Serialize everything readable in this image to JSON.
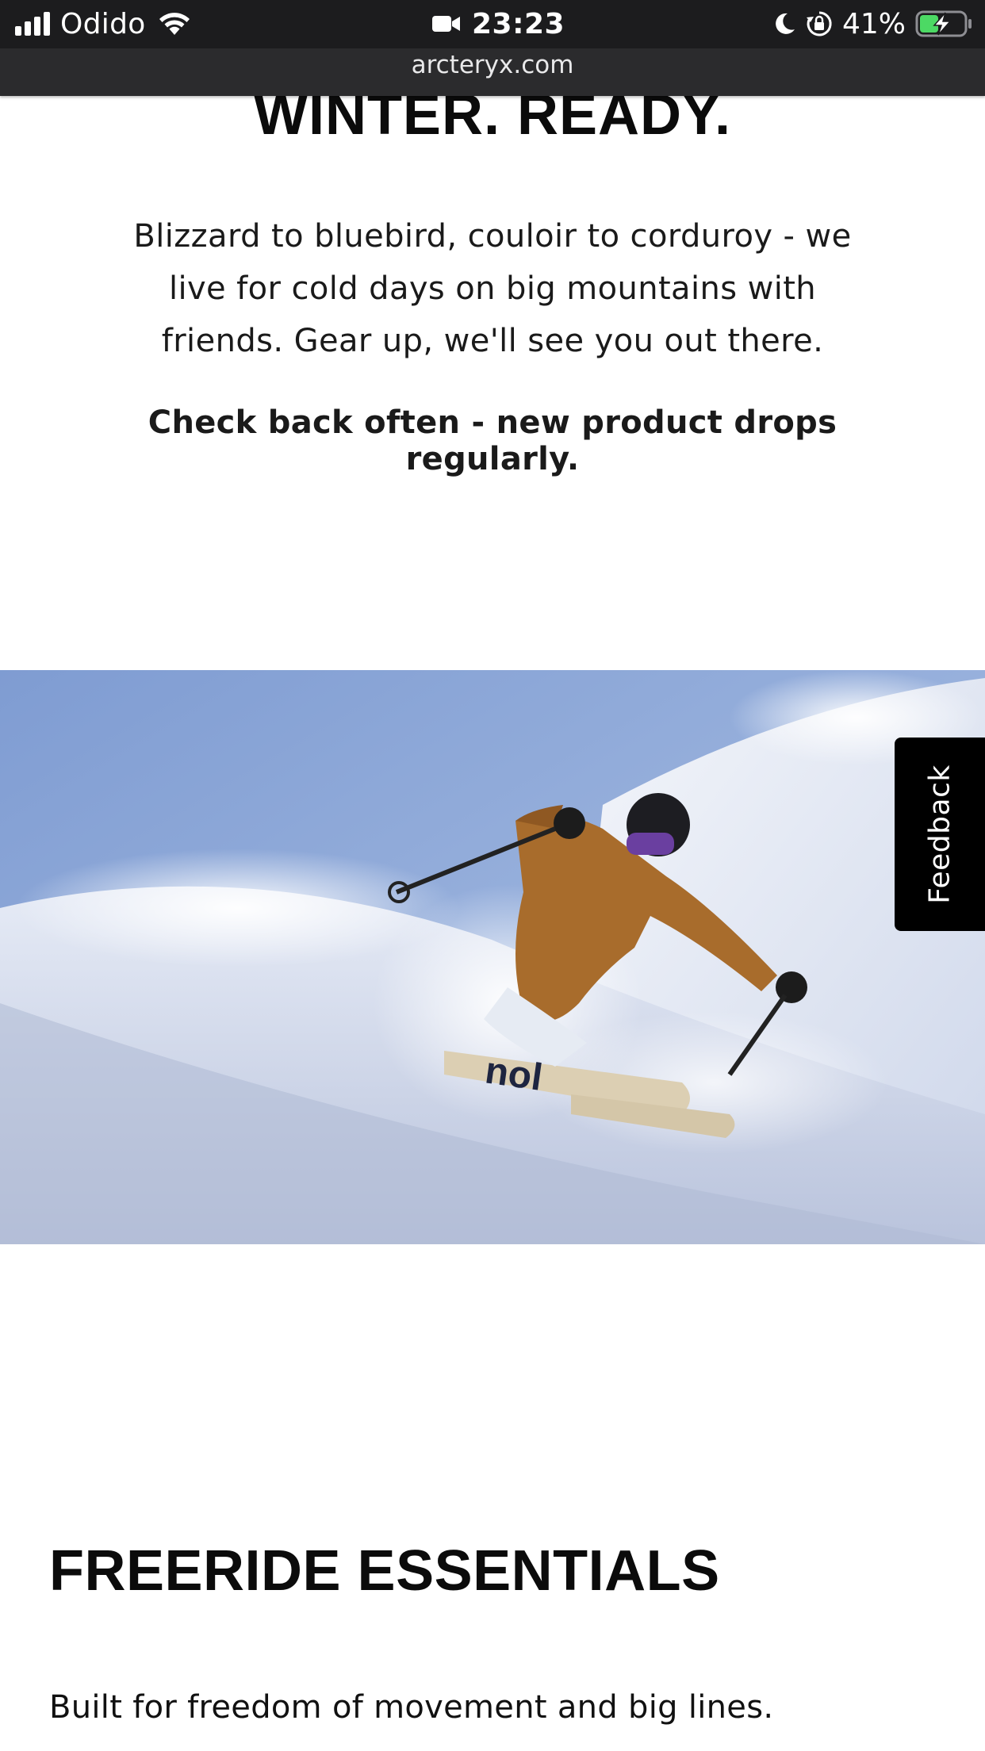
{
  "status_bar": {
    "carrier": "Odido",
    "time": "23:23",
    "battery_percent": "41%",
    "battery_level": 0.41,
    "icons": [
      "signal-icon",
      "wifi-icon",
      "video-camera-icon",
      "moon-icon",
      "rotation-lock-icon",
      "battery-charging-icon"
    ]
  },
  "browser": {
    "url": "arcteryx.com"
  },
  "hero": {
    "title": "WINTER. READY.",
    "body": "Blizzard to bluebird, couloir to corduroy - we live for cold days on big mountains with friends. Gear up, we'll see you out there.",
    "cta": "Check back often - new product drops regularly."
  },
  "feedback": {
    "label": "Feedback"
  },
  "section": {
    "title": "FREERIDE ESSENTIALS",
    "subtitle": "Built for freedom of movement and big lines."
  },
  "colors": {
    "status_bar_bg": "#1c1c1e",
    "url_bar_bg": "#2b2b2d",
    "battery_green": "#4cd964",
    "sky_blue": "#8ea8d6",
    "jacket_orange": "#a86c2c"
  }
}
